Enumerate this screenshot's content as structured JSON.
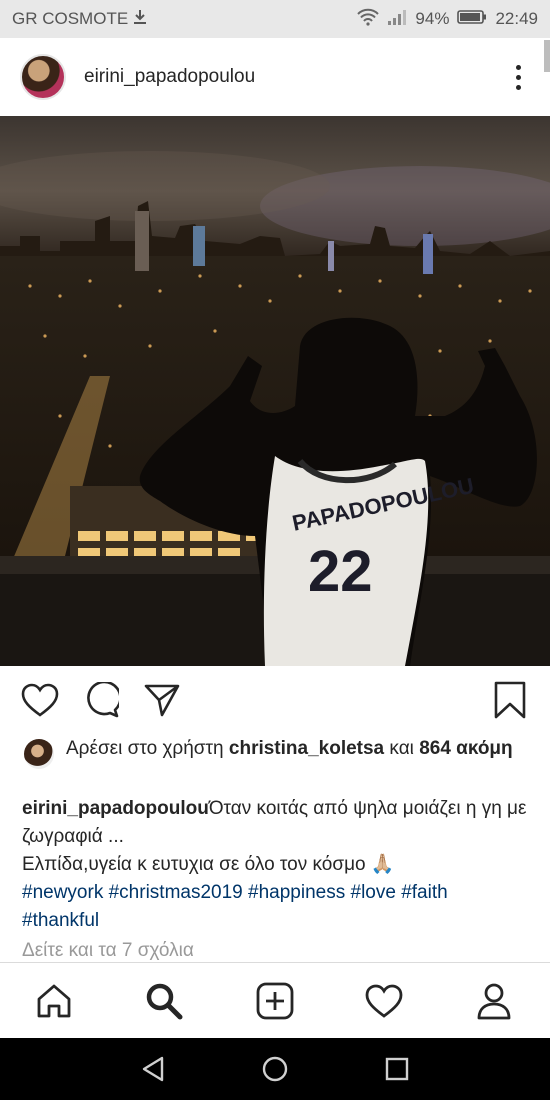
{
  "status_bar": {
    "carrier": "GR COSMOTE",
    "battery": "94%",
    "time": "22:49"
  },
  "post": {
    "username": "eirini_papadopoulou",
    "jersey_name": "PAPADOPOULOU",
    "jersey_number": "22"
  },
  "likes": {
    "prefix": "Αρέσει στο χρήστη",
    "user": "christina_koletsa",
    "middle": "και",
    "count": "864",
    "suffix": "ακόμη"
  },
  "caption": {
    "username": "eirini_papadopoulou",
    "line1": "Όταν κοιτάς από ψηλα μοιάζει η γη με ζωγραφιά ...",
    "line2": "Ελπίδα,υγεία κ ευτυχια σε όλο τον κόσμο 🙏🏼",
    "tags": [
      "#newyork",
      "#christmas2019",
      "#happiness",
      "#love",
      "#faith",
      "#thankful"
    ]
  },
  "comments_link": "Δείτε και τα 7 σχόλια",
  "icons": {
    "post_actions": [
      "heart-icon",
      "comment-icon",
      "share-icon",
      "bookmark-icon"
    ],
    "bottom_nav": [
      "home-icon",
      "search-icon",
      "add-post-icon",
      "activity-heart-icon",
      "profile-icon"
    ],
    "system_nav": [
      "back-icon",
      "home-circle-icon",
      "recents-icon"
    ]
  },
  "colors": {
    "text": "#262626",
    "hashtag": "#003569",
    "muted": "#999999",
    "status_bar_bg": "#e8e8e8"
  }
}
